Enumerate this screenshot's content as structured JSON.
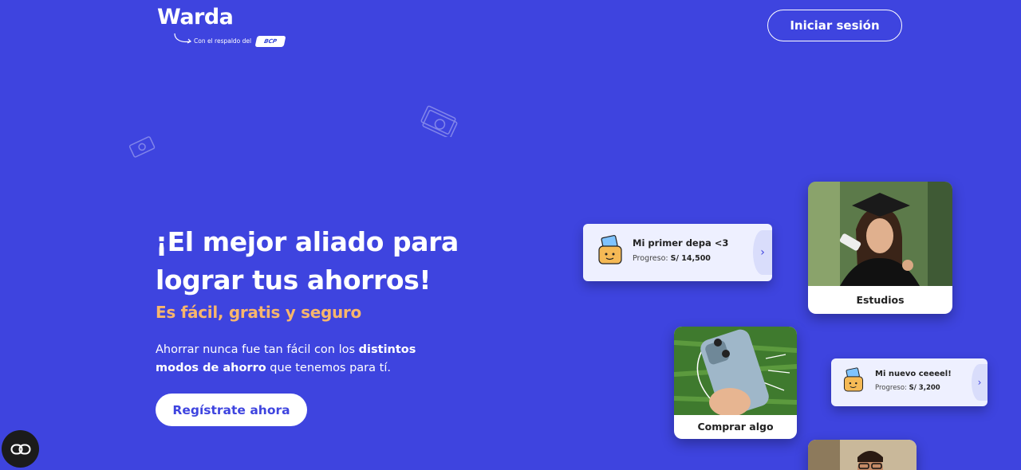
{
  "header": {
    "logo_text": "Warda",
    "tagline": "Con el respaldo del",
    "partner_badge": "BCP",
    "login_label": "Iniciar sesión"
  },
  "hero": {
    "title_line1": "¡El mejor aliado para",
    "title_line2": "lograr tus ahorros!",
    "subtitle": "Es fácil, gratis y seguro",
    "desc_part1": "Ahorrar nunca fue tan fácil con los ",
    "desc_bold1": "distintos",
    "desc_bold2": "modos de ahorro",
    "desc_part2": " que tenemos para tí.",
    "cta_label": "Regístrate ahora"
  },
  "goals": [
    {
      "name": "Mi primer depa <3",
      "progress_label": "Progreso:",
      "progress_value": "S/ 14,500"
    },
    {
      "name": "Mi nuevo ceeeel!",
      "progress_label": "Progreso:",
      "progress_value": "S/ 3,200"
    }
  ],
  "photo_cards": [
    {
      "label": "Estudios"
    },
    {
      "label": "Comprar algo"
    }
  ],
  "colors": {
    "background": "#3e44df",
    "accent_orange": "#f8b66c",
    "card_bg": "#eef0ff"
  }
}
